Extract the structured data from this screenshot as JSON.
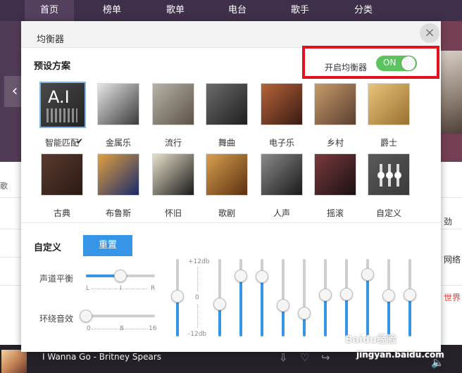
{
  "top_nav": {
    "items": [
      "首页",
      "榜单",
      "歌单",
      "电台",
      "歌手",
      "分类"
    ],
    "active_index": 0
  },
  "background": {
    "side_texts": [
      "劲",
      "网络",
      "世界"
    ],
    "left_fragment": "歌",
    "banner_arrow": "‹"
  },
  "player": {
    "track": "I Wanna Go - Britney Spears",
    "icons": [
      "download-icon",
      "heart-icon",
      "share-icon",
      "volume-icon"
    ],
    "glyphs": {
      "download": "⇩",
      "like": "♡",
      "share": "↪",
      "volume": "🔈"
    }
  },
  "watermark": {
    "text": "Baidu经验",
    "url": "jingyan.baidu.com"
  },
  "dialog": {
    "title": "均衡器",
    "close_glyph": "×",
    "presets_title": "预设方案",
    "toggle": {
      "label": "开启均衡器",
      "state": "ON",
      "enabled": true
    },
    "presets": [
      {
        "label": "智能匹配",
        "selected": true,
        "thumb_text": "A.I",
        "colors": [
          "#4a4a4a",
          "#222222"
        ]
      },
      {
        "label": "金属乐",
        "selected": false,
        "colors": [
          "#e6e6e6",
          "#3a3a3a"
        ]
      },
      {
        "label": "流行",
        "selected": false,
        "colors": [
          "#b8b2a8",
          "#5c5347"
        ]
      },
      {
        "label": "舞曲",
        "selected": false,
        "colors": [
          "#6b6b6b",
          "#1f1f1f"
        ]
      },
      {
        "label": "电子乐",
        "selected": false,
        "colors": [
          "#b5643a",
          "#3a1a12"
        ]
      },
      {
        "label": "乡村",
        "selected": false,
        "colors": [
          "#c79a6a",
          "#5a4030"
        ]
      },
      {
        "label": "爵士",
        "selected": false,
        "colors": [
          "#e8c47a",
          "#9a7030"
        ]
      },
      {
        "label": "古典",
        "selected": false,
        "colors": [
          "#5a3a2e",
          "#2a1a14"
        ]
      },
      {
        "label": "布鲁斯",
        "selected": false,
        "colors": [
          "#e0a040",
          "#1a2a6a"
        ]
      },
      {
        "label": "怀旧",
        "selected": false,
        "colors": [
          "#e8e0c8",
          "#1a1a1a"
        ]
      },
      {
        "label": "歌剧",
        "selected": false,
        "colors": [
          "#d9a050",
          "#5a3010"
        ]
      },
      {
        "label": "人声",
        "selected": false,
        "colors": [
          "#8a8a8a",
          "#1a1a1a"
        ]
      },
      {
        "label": "摇滚",
        "selected": false,
        "colors": [
          "#7a3a3a",
          "#1a1014"
        ]
      },
      {
        "label": "自定义",
        "selected": false,
        "colors": [
          "#5a5a5a",
          "#3a3a3a"
        ]
      }
    ],
    "custom": {
      "title": "自定义",
      "reset_label": "重置",
      "balance": {
        "label": "声道平衡",
        "scale": [
          "L",
          "I",
          "R"
        ],
        "value": 0.5
      },
      "surround": {
        "label": "环绕音效",
        "scale": [
          "0",
          "8",
          "16"
        ],
        "value": 0
      },
      "db_labels": [
        "+12db",
        "0",
        "-12db"
      ],
      "bands": [
        0.52,
        0.42,
        0.78,
        0.77,
        0.4,
        0.3,
        0.54,
        0.55,
        0.8,
        0.53,
        0.54
      ]
    }
  }
}
